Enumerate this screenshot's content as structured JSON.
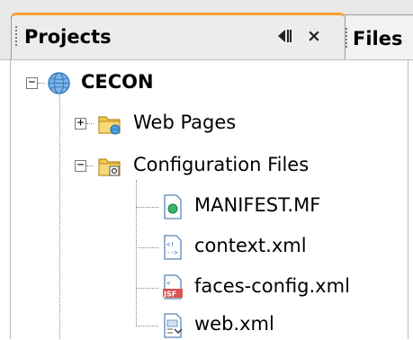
{
  "tabs": {
    "active": {
      "label": "Projects"
    },
    "inactive": {
      "label": "Files"
    }
  },
  "tree": {
    "root": {
      "label": "CECON",
      "icon": "globe-icon",
      "expanded": true
    },
    "web_pages": {
      "label": "Web Pages",
      "icon": "web-folder-icon",
      "expanded": false
    },
    "configuration_files": {
      "label": "Configuration Files",
      "icon": "config-folder-icon",
      "expanded": true
    },
    "files": [
      {
        "label": "MANIFEST.MF",
        "icon": "manifest-file-icon"
      },
      {
        "label": "context.xml",
        "icon": "xml-file-icon"
      },
      {
        "label": "faces-config.xml",
        "icon": "jsf-file-icon"
      },
      {
        "label": "web.xml",
        "icon": "web-xml-file-icon"
      }
    ]
  },
  "colors": {
    "active_tab_accent": "#f7a032",
    "folder": "#f2c94c",
    "globe": "#3b7fc4"
  }
}
